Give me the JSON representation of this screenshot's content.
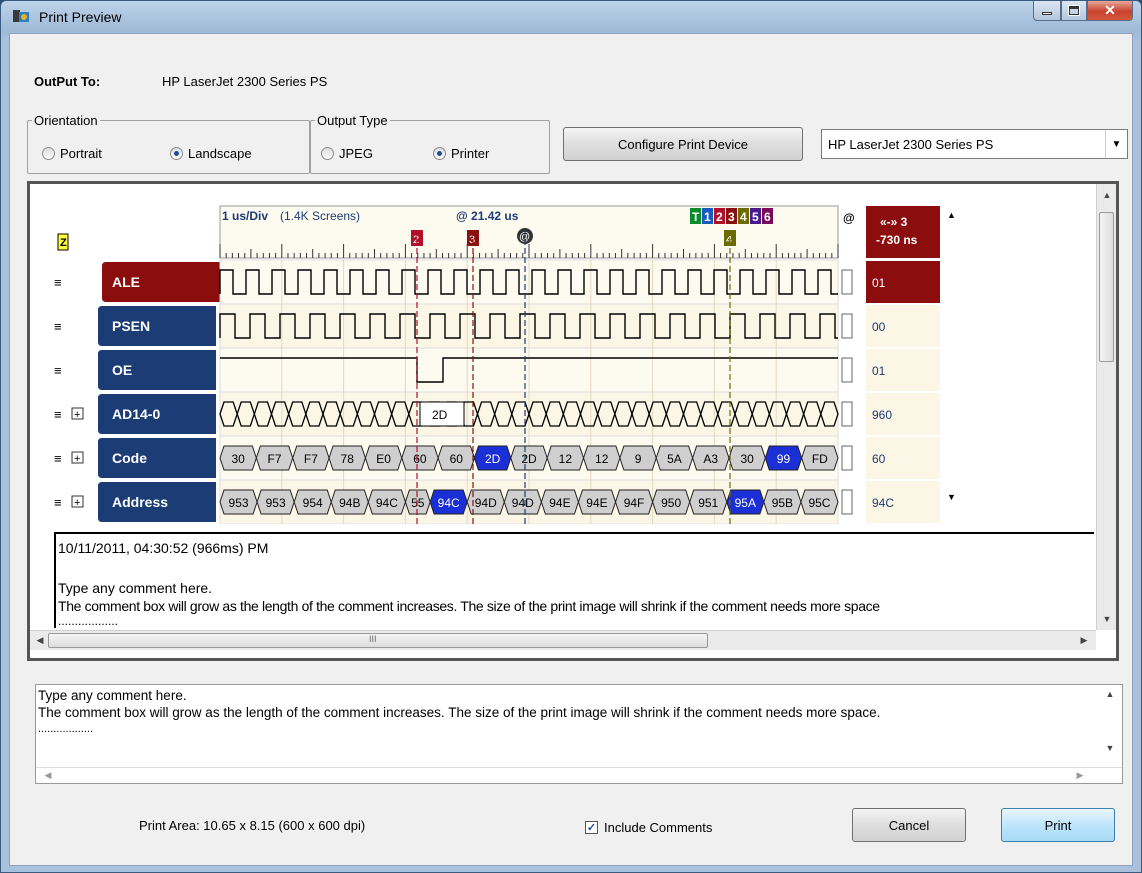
{
  "window": {
    "title": "Print Preview"
  },
  "output": {
    "label": "OutPut To:",
    "value": "HP LaserJet 2300 Series PS"
  },
  "orientation": {
    "title": "Orientation",
    "portrait": "Portrait",
    "landscape": "Landscape",
    "selected": "Landscape"
  },
  "output_type": {
    "title": "Output Type",
    "jpeg": "JPEG",
    "printer": "Printer",
    "selected": "Printer"
  },
  "configure_button": "Configure Print Device",
  "device_select": {
    "value": "HP LaserJet 2300 Series PS"
  },
  "waveform": {
    "timebase": "1 us/Div",
    "screens": "(1.4K Screens)",
    "cursor_time": "@ 21.42 us",
    "delta_label": "«-» 3",
    "delta_value": "-730 ns",
    "z_marker": "Z",
    "markers": [
      {
        "label": "T",
        "color": "#0a8a2a"
      },
      {
        "label": "1",
        "color": "#1a5bbf"
      },
      {
        "label": "2",
        "color": "#b0102a"
      },
      {
        "label": "3",
        "color": "#8a1010"
      },
      {
        "label": "4",
        "color": "#6b6b00"
      },
      {
        "label": "5",
        "color": "#4a1a8a"
      },
      {
        "label": "6",
        "color": "#7a0a5a"
      }
    ],
    "time_markers": {
      "m2": "2",
      "m3": "3",
      "m4": "4",
      "cursor": "@"
    },
    "signals": [
      {
        "name": "ALE",
        "value": "01",
        "expand": false,
        "label_color": "#8b0d0d",
        "value_bg": "#8b0d0d",
        "value_color": "#ffffff"
      },
      {
        "name": "PSEN",
        "value": "00",
        "expand": false,
        "label_color": "#1b3c74",
        "value_bg": "#fbf6e6",
        "value_color": "#1b3c74"
      },
      {
        "name": "OE",
        "value": "01",
        "expand": false,
        "label_color": "#1b3c74",
        "value_bg": "#fbf6e6",
        "value_color": "#1b3c74"
      },
      {
        "name": "AD14-0",
        "value": "960",
        "expand": true,
        "label_color": "#1b3c74",
        "value_bg": "#fbf6e6",
        "value_color": "#1b3c74"
      },
      {
        "name": "Code",
        "value": "60",
        "expand": true,
        "label_color": "#1b3c74",
        "value_bg": "#fbf6e6",
        "value_color": "#1b3c74"
      },
      {
        "name": "Address",
        "value": "94C",
        "expand": true,
        "label_color": "#1b3c74",
        "value_bg": "#fbf6e6",
        "value_color": "#1b3c74"
      }
    ],
    "ad_bus_label": "2D",
    "code_bus": [
      "30",
      "F7",
      "F7",
      "78",
      "E0",
      "60",
      "60",
      "2D",
      "2D",
      "12",
      "12",
      "9",
      "5A",
      "A3",
      "30",
      "99",
      "FD"
    ],
    "address_bus": [
      "953",
      "953",
      "954",
      "94B",
      "94C",
      "55",
      "94C",
      "94D",
      "94D",
      "94E",
      "94E",
      "94F",
      "950",
      "951",
      "95A",
      "95B",
      "95C"
    ]
  },
  "preview_comment": {
    "timestamp": "10/11/2011, 04:30:52 (966ms) PM",
    "line1": "Type any comment here.",
    "line2": "The comment box will grow as the length of the comment increases. The size of the print image will shrink if the comment needs more space",
    "line3": "..................",
    "scroll_mark": "III"
  },
  "comment": {
    "line1": "Type any comment here.",
    "line2": "The comment box will grow as the length of the comment increases. The size of the print image will shrink if the comment needs more space.",
    "line3": ".................."
  },
  "footer": {
    "print_area": "Print Area: 10.65 x 8.15  (600 x 600 dpi)",
    "include_comments": "Include Comments",
    "include_checked": true,
    "cancel": "Cancel",
    "print": "Print"
  }
}
